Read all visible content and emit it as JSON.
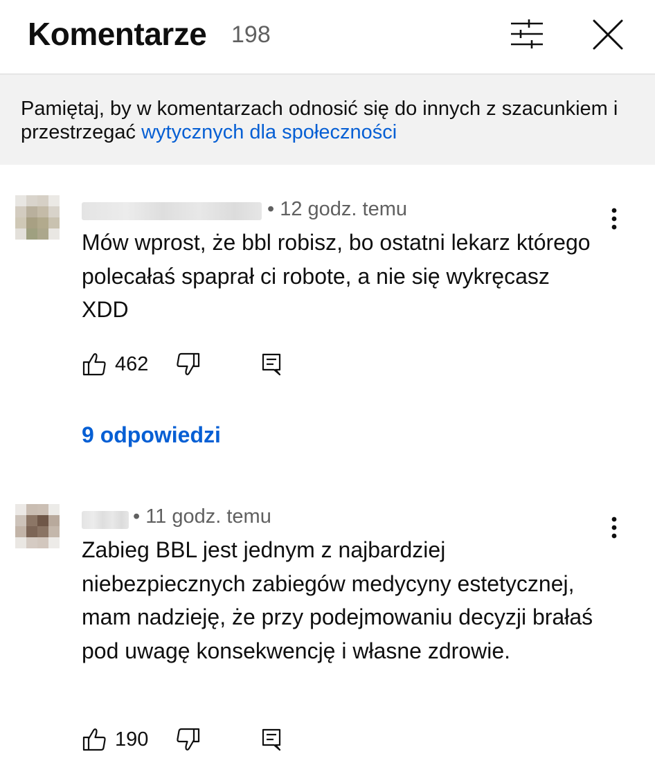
{
  "header": {
    "title": "Komentarze",
    "count": "198",
    "filter_icon": "sliders-icon",
    "close_icon": "close-icon"
  },
  "banner": {
    "text": "Pamiętaj, by w komentarzach odnosić się do innych z szacunkiem i przestrzegać ",
    "link": "wytycznych dla społeczności"
  },
  "comments": [
    {
      "meta": "• 12 godz. temu",
      "text": "Mów wprost, że bbl robisz, bo ostatni lekarz którego polecałaś spaprał ci robote, a nie się wykręcasz XDD",
      "likes": "462",
      "replies": "9 odpowiedzi"
    },
    {
      "meta": "• 11 godz. temu",
      "text": "Zabieg BBL jest jednym z najbardziej niebezpiecznych zabiegów medycyny estetycznej, mam nadzieję, że przy podejmowaniu decyzji brałaś pod uwagę konsekwencję i własne zdrowie.",
      "likes": "190"
    }
  ],
  "colors": {
    "link": "#065fd4",
    "secondary_text": "#606060",
    "banner_bg": "#f2f2f2"
  }
}
